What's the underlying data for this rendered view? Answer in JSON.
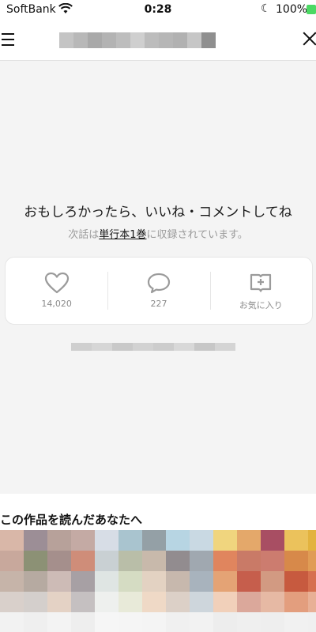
{
  "status_bar": {
    "carrier": "SoftBank",
    "time": "0:28",
    "battery": "100%"
  },
  "header": {
    "title_mosaic_colors": [
      "#c4c4c4",
      "#b8b8b8",
      "#a9a9a9",
      "#b3b3b3",
      "#bdbdbd",
      "#cfcfcf",
      "#bcbcbc",
      "#b6b6b6",
      "#b1b1b1",
      "#c6c6c6",
      "#8f8f8f"
    ]
  },
  "main": {
    "prompt": "おもしろかったら、いいね・コメントしてね",
    "note_prefix": "次話は",
    "note_link": "単行本1巻",
    "note_suffix": "に収録されています。",
    "actions": {
      "like_count": "14,020",
      "comment_count": "227",
      "favorite_label": "お気に入り"
    },
    "blurred_line_colors": [
      "#cfcfcf",
      "#d6d6d6",
      "#c9c9c9",
      "#d2d2d2",
      "#cccccc",
      "#d8d8d8",
      "#c7c7c7",
      "#d4d4d4"
    ]
  },
  "recommend": {
    "heading": "この作品を読んだあなたへ",
    "thumb_rows": [
      [
        "#d9b7a8",
        "#9c8e96",
        "#b7a19a",
        "#c4aaa4",
        "#d7dde6",
        "#a9c4cf",
        "#94a0a6",
        "#b7d5e3",
        "#c9d9e3",
        "#f0d57e",
        "#e4a86a",
        "#a84e63",
        "#ebc25c",
        "#e3b33f"
      ],
      [
        "#c8a89c",
        "#8c9175",
        "#a58f8c",
        "#cf8d79",
        "#c9d0d3",
        "#b9bea8",
        "#c8b9ab",
        "#928c8f",
        "#a0a8b0",
        "#e0855e",
        "#c97a67",
        "#cc7c6f",
        "#d7894a",
        "#e09c55"
      ],
      [
        "#c6b4a9",
        "#b6aaa1",
        "#cdbbb6",
        "#a7a0a4",
        "#dfe5e3",
        "#d5dcc3",
        "#e3d2c2",
        "#c7b8ad",
        "#a8b3bd",
        "#e4a375",
        "#c65e4c",
        "#d29a82",
        "#c75a3f",
        "#d6704f"
      ],
      [
        "#d9d0cb",
        "#d4cfcc",
        "#e4d2c5",
        "#c5c0c1",
        "#eef0ee",
        "#e8ead9",
        "#efd9c6",
        "#dcd0c7",
        "#ced6dc",
        "#f1d0ba",
        "#dba89b",
        "#e6b9a4",
        "#e39e7e",
        "#e8b096"
      ],
      [
        "#f2f2f2",
        "#efefef",
        "#f3f3f3",
        "#eeeeee",
        "#f6f6f6",
        "#f5f5f5",
        "#f4f4f4",
        "#f0f0f0",
        "#f2f2f2",
        "#ededed",
        "#efefef",
        "#eeeeee",
        "#f1f1f1",
        "#f0f0f0"
      ]
    ]
  },
  "colors": {
    "background": "#f4f4f4",
    "card": "#ffffff",
    "icon_gray": "#9b9b9b"
  }
}
